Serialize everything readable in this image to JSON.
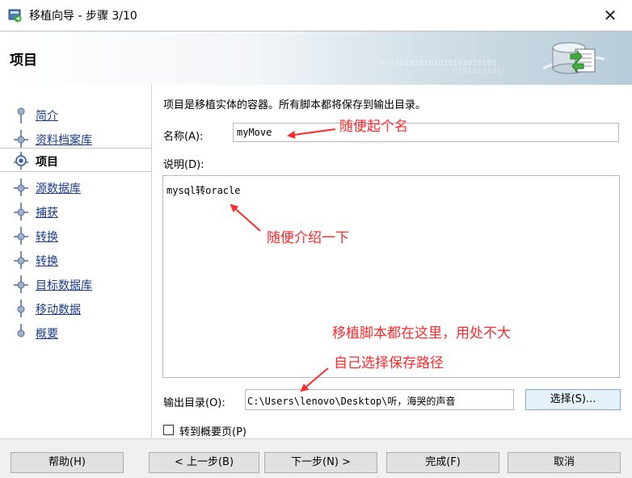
{
  "window": {
    "title": "移植向导 - 步骤 3/10",
    "close_glyph": "✕"
  },
  "header": {
    "title": "项目",
    "binary_line1": "010101010101010101010101",
    "binary_line2": "0101010101"
  },
  "sidebar": {
    "items": [
      {
        "label": "简介",
        "current": false
      },
      {
        "label": "资料档案库",
        "current": false
      },
      {
        "label": "项目",
        "current": true
      },
      {
        "label": "源数据库",
        "current": false
      },
      {
        "label": "捕获",
        "current": false
      },
      {
        "label": "转换",
        "current": false
      },
      {
        "label": "转换",
        "current": false
      },
      {
        "label": "目标数据库",
        "current": false
      },
      {
        "label": "移动数据",
        "current": false
      },
      {
        "label": "概要",
        "current": false
      }
    ]
  },
  "main": {
    "description": "项目是移植实体的容器。所有脚本都将保存到输出目录。",
    "name_label": "名称(A):",
    "name_value": "myMove",
    "desc_label": "说明(D):",
    "desc_value": "mysql转oracle",
    "output_label": "输出目录(O):",
    "output_value": "C:\\Users\\lenovo\\Desktop\\听，海哭的声音",
    "choose_button": "选择(S)...",
    "goto_summary_label": "转到概要页(P)",
    "goto_summary_checked": false
  },
  "footer": {
    "help": "帮助(H)",
    "back": "< 上一步(B)",
    "next": "下一步(N) >",
    "finish": "完成(F)",
    "cancel": "取消"
  },
  "annotations": {
    "name_note": "随便起个名",
    "desc_note": "随便介绍一下",
    "script_note": "移植脚本都在这里，用处不大",
    "path_note": "自己选择保存路径",
    "color": "#ff2a2a"
  },
  "colors": {
    "accent": "#1b3a8c",
    "header_gradient_end": "#b7ccd9",
    "button_highlight": "#e5f1fb"
  }
}
